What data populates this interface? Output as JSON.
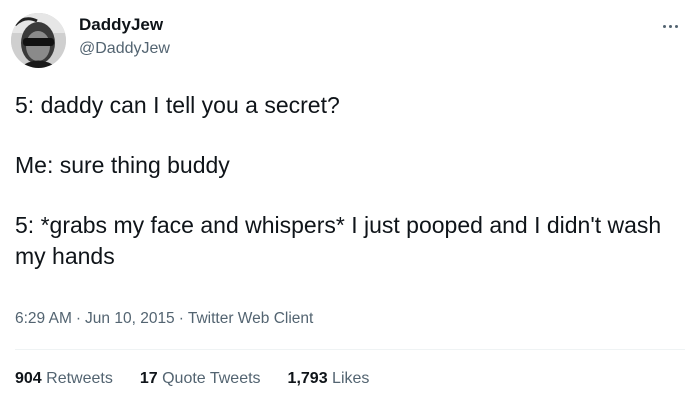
{
  "author": {
    "display_name": "DaddyJew",
    "handle": "@DaddyJew"
  },
  "icons": {
    "avatar": "avatar-photo",
    "more": "more-horizontal-icon"
  },
  "tweet": {
    "lines": [
      "5: daddy can I tell you a secret?",
      "Me: sure thing buddy",
      "5: *grabs my face and whispers* I just pooped and I didn't wash my hands"
    ],
    "time": "6:29 AM",
    "date": "Jun 10, 2015",
    "client": "Twitter Web Client",
    "separator": "·"
  },
  "stats": {
    "retweets": {
      "count": "904",
      "label": "Retweets"
    },
    "quotes": {
      "count": "17",
      "label": "Quote Tweets"
    },
    "likes": {
      "count": "1,793",
      "label": "Likes"
    }
  },
  "colors": {
    "text": "#0f1419",
    "secondary": "#536471",
    "divider": "#eff3f4"
  }
}
